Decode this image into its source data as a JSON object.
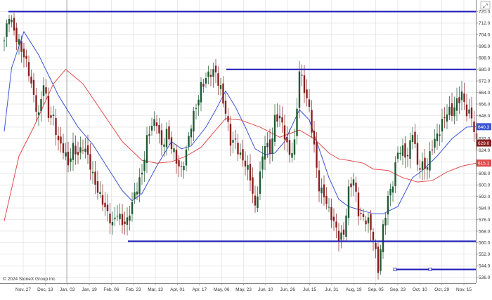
{
  "copyright": "© 2024 StoneX Group Inc.",
  "corner_icon": "expand-icon",
  "colors": {
    "up_bar": "#1f5a32",
    "down_bar": "#8a1f1f",
    "ma_fast": "#3a55d6",
    "ma_slow": "#e34a4a",
    "hline": "#1a1ab8",
    "grid": "#dcdcdc",
    "price_badge": "#3a55d6",
    "price_badge_dark": "#8a1f1f",
    "price_badge_red": "#e34a4a"
  },
  "chart_data": {
    "type": "candlestick",
    "title": "",
    "xlabel": "",
    "ylabel": "",
    "ylim": [
      532,
      728
    ],
    "y_ticks": [
      "536.0",
      "544.0",
      "552.0",
      "560.0",
      "568.0",
      "576.0",
      "584.0",
      "592.0",
      "600.0",
      "608.0",
      "616.0",
      "624.0",
      "632.0",
      "640.0",
      "648.0",
      "656.0",
      "664.0",
      "672.0",
      "680.0",
      "688.0",
      "696.0",
      "704.0",
      "712.0",
      "720.0"
    ],
    "x_ticks": [
      "Nov, 27",
      "Dec, 13",
      "Jan, 03",
      "Jan, 19",
      "Feb, 06",
      "Feb, 23",
      "Mar, 13",
      "Apr, 01",
      "Apr, 17",
      "May, 06",
      "May, 23",
      "Jun, 10",
      "Jun, 26",
      "Jul, 15",
      "Jul, 31",
      "Aug, 19",
      "Sep, 05",
      "Sep, 23",
      "Oct, 10",
      "Oct, 29",
      "Nov, 15"
    ],
    "price_labels": [
      {
        "text": "640.3",
        "value": 640.3,
        "series": "fast_ma"
      },
      {
        "text": "629.0",
        "value": 629.0,
        "series": "last"
      },
      {
        "text": "615.1",
        "value": 615.1,
        "series": "slow_ma"
      }
    ],
    "horizontal_lines": [
      {
        "value": 720,
        "x_from": "Nov, 27"
      },
      {
        "value": 680,
        "x_from": "May, 06"
      },
      {
        "value": 561,
        "x_from": "Feb, 23"
      },
      {
        "value": 541.5,
        "x_from": "Sep, 12",
        "handles": true
      }
    ],
    "close_path": [
      [
        0,
        700
      ],
      [
        2,
        716
      ],
      [
        4,
        706
      ],
      [
        6,
        700
      ],
      [
        8,
        690
      ],
      [
        10,
        676
      ],
      [
        12,
        660
      ],
      [
        14,
        650
      ],
      [
        16,
        672
      ],
      [
        18,
        646
      ],
      [
        20,
        645
      ],
      [
        22,
        632
      ],
      [
        24,
        626
      ],
      [
        26,
        612
      ],
      [
        28,
        625
      ],
      [
        30,
        623
      ],
      [
        32,
        628
      ],
      [
        34,
        618
      ],
      [
        36,
        605
      ],
      [
        38,
        598
      ],
      [
        40,
        590
      ],
      [
        42,
        578
      ],
      [
        44,
        571
      ],
      [
        46,
        583
      ],
      [
        48,
        575
      ],
      [
        50,
        573
      ],
      [
        52,
        586
      ],
      [
        54,
        600
      ],
      [
        56,
        610
      ],
      [
        58,
        630
      ],
      [
        60,
        640
      ],
      [
        62,
        645
      ],
      [
        64,
        628
      ],
      [
        66,
        635
      ],
      [
        68,
        625
      ],
      [
        70,
        618
      ],
      [
        72,
        612
      ],
      [
        74,
        622
      ],
      [
        76,
        640
      ],
      [
        78,
        655
      ],
      [
        80,
        670
      ],
      [
        82,
        673
      ],
      [
        84,
        676
      ],
      [
        86,
        678
      ],
      [
        88,
        668
      ],
      [
        90,
        650
      ],
      [
        92,
        628
      ],
      [
        94,
        630
      ],
      [
        96,
        622
      ],
      [
        98,
        615
      ],
      [
        100,
        603
      ],
      [
        102,
        583
      ],
      [
        104,
        610
      ],
      [
        106,
        630
      ],
      [
        108,
        620
      ],
      [
        110,
        645
      ],
      [
        112,
        650
      ],
      [
        114,
        635
      ],
      [
        116,
        618
      ],
      [
        118,
        628
      ],
      [
        120,
        682
      ],
      [
        122,
        667
      ],
      [
        124,
        650
      ],
      [
        126,
        625
      ],
      [
        128,
        600
      ],
      [
        130,
        594
      ],
      [
        132,
        580
      ],
      [
        134,
        573
      ],
      [
        136,
        566
      ],
      [
        138,
        567
      ],
      [
        140,
        594
      ],
      [
        142,
        603
      ],
      [
        144,
        583
      ],
      [
        146,
        578
      ],
      [
        148,
        573
      ],
      [
        150,
        562
      ],
      [
        152,
        543
      ],
      [
        154,
        572
      ],
      [
        156,
        589
      ],
      [
        158,
        600
      ],
      [
        160,
        625
      ],
      [
        162,
        626
      ],
      [
        164,
        618
      ],
      [
        166,
        636
      ],
      [
        168,
        615
      ],
      [
        170,
        615
      ],
      [
        172,
        612
      ],
      [
        174,
        625
      ],
      [
        176,
        635
      ],
      [
        178,
        645
      ],
      [
        180,
        650
      ],
      [
        182,
        648
      ],
      [
        184,
        658
      ],
      [
        186,
        665
      ],
      [
        188,
        650
      ],
      [
        190,
        645
      ],
      [
        192,
        629
      ]
    ],
    "series": [
      {
        "name": "fast_ma",
        "points": [
          [
            0,
            637
          ],
          [
            3,
            681
          ],
          [
            8,
            706
          ],
          [
            14,
            690
          ],
          [
            22,
            662
          ],
          [
            30,
            640
          ],
          [
            36,
            628
          ],
          [
            42,
            612
          ],
          [
            48,
            596
          ],
          [
            52,
            589
          ],
          [
            56,
            594
          ],
          [
            62,
            613
          ],
          [
            68,
            630
          ],
          [
            72,
            625
          ],
          [
            76,
            627
          ],
          [
            82,
            640
          ],
          [
            86,
            652
          ],
          [
            90,
            665
          ],
          [
            94,
            654
          ],
          [
            98,
            640
          ],
          [
            102,
            625
          ],
          [
            106,
            621
          ],
          [
            110,
            622
          ],
          [
            114,
            630
          ],
          [
            120,
            652
          ],
          [
            124,
            645
          ],
          [
            128,
            625
          ],
          [
            132,
            605
          ],
          [
            136,
            590
          ],
          [
            140,
            585
          ],
          [
            146,
            582
          ],
          [
            150,
            580
          ],
          [
            154,
            580
          ],
          [
            160,
            585
          ],
          [
            166,
            605
          ],
          [
            170,
            610
          ],
          [
            176,
            620
          ],
          [
            182,
            632
          ],
          [
            188,
            640
          ],
          [
            192,
            640.3
          ]
        ]
      },
      {
        "name": "slow_ma",
        "points": [
          [
            0,
            575
          ],
          [
            6,
            620
          ],
          [
            12,
            640
          ],
          [
            20,
            670
          ],
          [
            25,
            680
          ],
          [
            32,
            670
          ],
          [
            40,
            650
          ],
          [
            48,
            630
          ],
          [
            56,
            617
          ],
          [
            62,
            615
          ],
          [
            68,
            616
          ],
          [
            74,
            620
          ],
          [
            80,
            626
          ],
          [
            86,
            638
          ],
          [
            90,
            646
          ],
          [
            96,
            645
          ],
          [
            104,
            640
          ],
          [
            112,
            633
          ],
          [
            120,
            638
          ],
          [
            126,
            632
          ],
          [
            132,
            622
          ],
          [
            136,
            618
          ],
          [
            140,
            617
          ],
          [
            146,
            615
          ],
          [
            150,
            611
          ],
          [
            156,
            610
          ],
          [
            162,
            605
          ],
          [
            168,
            602
          ],
          [
            174,
            603
          ],
          [
            180,
            609
          ],
          [
            186,
            613
          ],
          [
            192,
            615.1
          ]
        ]
      }
    ]
  }
}
